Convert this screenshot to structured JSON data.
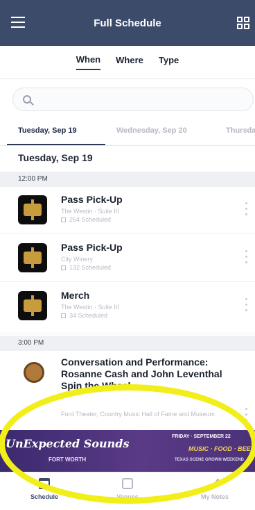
{
  "header": {
    "title": "Full Schedule",
    "menu_icon": "menu-icon",
    "grid_icon": "grid-view-icon"
  },
  "filters": [
    "When",
    "Where",
    "Type"
  ],
  "search": {
    "placeholder": "",
    "icon": "search-icon"
  },
  "date_tabs": [
    "Tuesday, Sep 19",
    "Wednesday, Sep 20",
    "Thursday"
  ],
  "day_heading": "Tuesday, Sep 19",
  "sections": [
    {
      "time": "12:00 PM",
      "events": [
        {
          "title": "Pass Pick-Up",
          "venue": "The Westin · Suite III",
          "scheduled": "264 Scheduled"
        },
        {
          "title": "Pass Pick-Up",
          "venue": "City Winery",
          "scheduled": "132 Scheduled"
        },
        {
          "title": "Merch",
          "venue": "The Westin · Suite III",
          "scheduled": "34 Scheduled"
        }
      ]
    },
    {
      "time": "3:00 PM",
      "events": [
        {
          "title": "Conversation and Performance: Rosanne Cash and John Leventhal Spin the Wheel",
          "venue": "Ford Theater, Country Music Hall of Fame and Museum"
        }
      ]
    }
  ],
  "banner": {
    "title": "UnExpected Sounds",
    "sub": "FORT WORTH",
    "date": "FRIDAY · SEPTEMBER 22",
    "tag": "MUSIC · FOOD · BEER",
    "small": "TEXAS SCENE GROWN WEEKEND"
  },
  "bottom_nav": [
    {
      "label": "Schedule",
      "active": true
    },
    {
      "label": "Venues",
      "active": false
    },
    {
      "label": "My Notes",
      "active": false
    }
  ],
  "colors": {
    "header": "#3d4b6b",
    "highlight": "#f2ee1a",
    "banner": "#4b3278"
  }
}
